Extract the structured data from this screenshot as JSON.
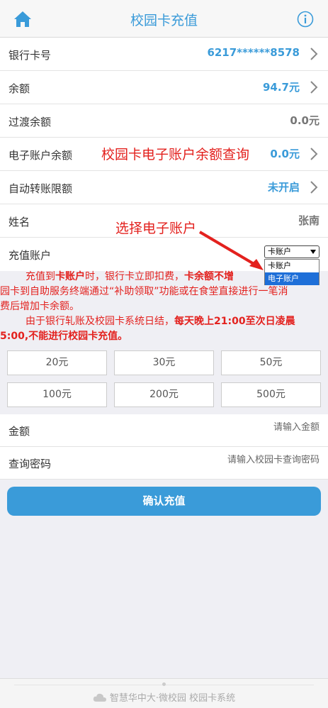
{
  "header": {
    "title": "校园卡充值"
  },
  "account": {
    "rows": [
      {
        "label": "银行卡号",
        "value": "6217******8578"
      },
      {
        "label": "余额",
        "value": "94.7元"
      },
      {
        "label": "过渡余额",
        "value": "0.0元"
      },
      {
        "label": "电子账户余额",
        "value": "0.0元"
      },
      {
        "label": "自动转账限额",
        "value": "未开启"
      },
      {
        "label": "姓名",
        "value": "张南"
      },
      {
        "label": "充值账户"
      }
    ]
  },
  "select": {
    "value": "卡账户",
    "options": [
      "卡账户",
      "电子账户"
    ],
    "highlighted": "电子账户"
  },
  "annotations": {
    "query": "校园卡电子账户余额查询",
    "choose": "选择电子账户"
  },
  "notice": {
    "p1_a": "充值到",
    "p1_b": "卡账户",
    "p1_c": "时，银行卡立即扣费，",
    "p1_d": "卡余额不增",
    "p1_e": "园卡到自助服务终端通过“补助领取”功能或在食堂直接进行一笔消",
    "p1_f": "费后增加卡余额。",
    "p2_a": "由于银行轧账及校园卡系统日结，",
    "p2_b": "每天晚上21:00至次日凌晨",
    "p2_c": "5:00,不能进行校园卡充值。"
  },
  "amounts": [
    "20元",
    "30元",
    "50元",
    "100元",
    "200元",
    "500元"
  ],
  "form": {
    "amount_label": "金额",
    "amount_placeholder": "请输入金额",
    "password_label": "查询密码",
    "password_placeholder": "请输入校园卡查询密码"
  },
  "confirm_label": "确认充值",
  "footer": {
    "text": "智慧华中大·微校园    校园卡系统"
  },
  "colors": {
    "accent": "#3a9bd9",
    "annotation": "#e3211e"
  }
}
